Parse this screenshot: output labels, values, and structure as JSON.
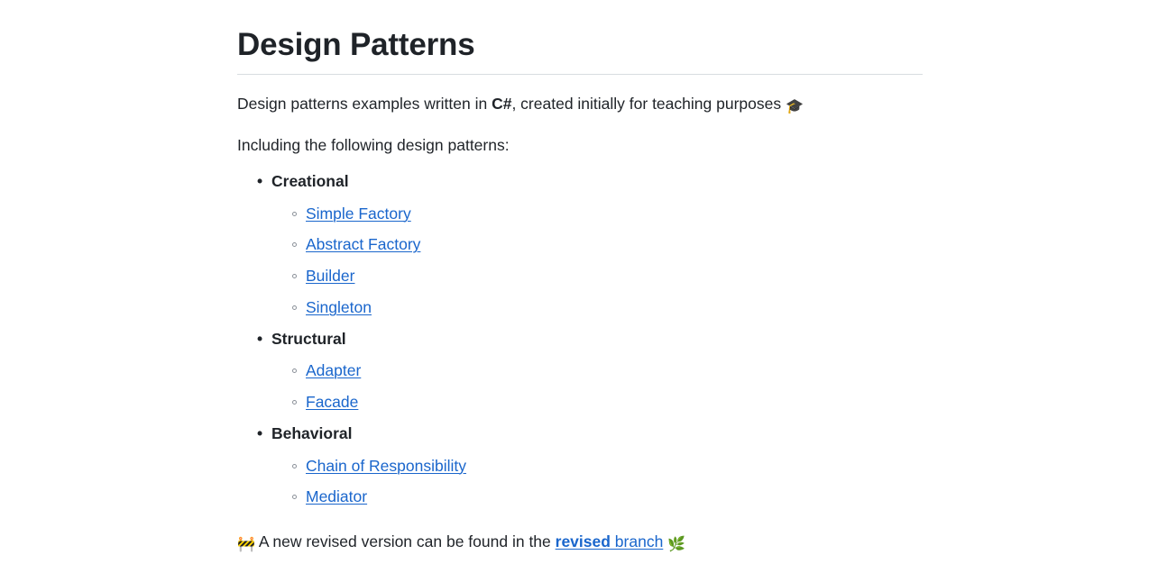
{
  "document": {
    "title": "Design Patterns",
    "intro": {
      "before_language": "Design patterns examples written in ",
      "language": "C#",
      "after_language": ", created initially for teaching purposes ",
      "emoji": "🎓",
      "emoji_name": "graduation-cap"
    },
    "including_line": "Including the following design patterns:",
    "groups": [
      {
        "label": "Creational",
        "items": [
          {
            "label": "Simple Factory"
          },
          {
            "label": "Abstract Factory"
          },
          {
            "label": "Builder"
          },
          {
            "label": "Singleton"
          }
        ]
      },
      {
        "label": "Structural",
        "items": [
          {
            "label": "Adapter"
          },
          {
            "label": "Facade"
          }
        ]
      },
      {
        "label": "Behavioral",
        "items": [
          {
            "label": "Chain of Responsibility"
          },
          {
            "label": "Mediator"
          }
        ]
      }
    ],
    "footer": {
      "lead_emoji": "🚧",
      "lead_emoji_name": "construction-sign",
      "text_before_link": " A new revised version can be found in the ",
      "link_bold_part": "revised",
      "link_rest_part": " branch",
      "trailing_emoji": "🌿",
      "trailing_emoji_name": "herb"
    }
  },
  "colors": {
    "text": "#1f2328",
    "link": "#1a66cc",
    "rule": "#d8dce0",
    "sub_bullet": "#8b9199",
    "background": "#ffffff"
  }
}
